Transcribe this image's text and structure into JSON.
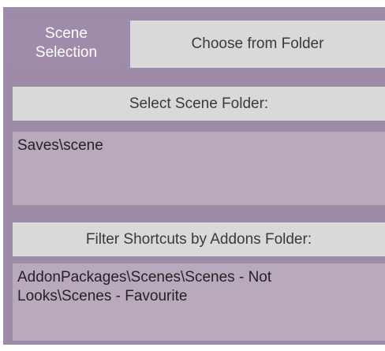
{
  "scene_selection": {
    "label": "Scene\nSelection",
    "choose_button": "Choose from Folder"
  },
  "scene_folder": {
    "button_label": "Select Scene Folder:",
    "value": "Saves\\scene"
  },
  "addons_filter": {
    "button_label": "Filter Shortcuts by Addons Folder:",
    "value": "AddonPackages\\Scenes\\Scenes - Not\nLooks\\Scenes - Favourite"
  },
  "colors": {
    "panel_bg": "#9d8ba7",
    "button_bg": "#d9d9d9",
    "field_bg": "#b9a9bd",
    "label_text": "#ffffff"
  }
}
